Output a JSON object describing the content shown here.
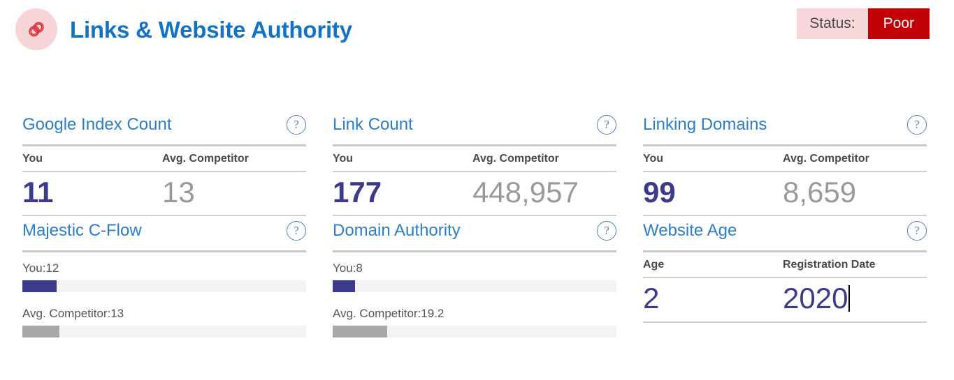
{
  "header": {
    "icon": "chain-link-icon",
    "title": "Links & Website Authority",
    "status_label": "Status:",
    "status_value": "Poor",
    "title_color": "#1273c6",
    "badge_bg": "#f7d4d7",
    "status_label_bg": "#f8d7da",
    "status_value_bg": "#c20008"
  },
  "help_icon_glyph": "?",
  "colors": {
    "you": "#3b3b8c",
    "competitor": "#9a9a9a",
    "card_title": "#2a7fc9",
    "bar_track": "#f4f4f4",
    "bar_you": "#3b3b8c",
    "bar_comp": "#a8a8a8"
  },
  "cards": [
    {
      "id": "google-index-count",
      "type": "stat",
      "title": "Google Index Count",
      "col1_head": "You",
      "col2_head": "Avg. Competitor",
      "col1_value": "11",
      "col2_value": "13"
    },
    {
      "id": "link-count",
      "type": "stat",
      "title": "Link Count",
      "col1_head": "You",
      "col2_head": "Avg. Competitor",
      "col1_value": "177",
      "col2_value": "448,957"
    },
    {
      "id": "linking-domains",
      "type": "stat",
      "title": "Linking Domains",
      "col1_head": "You",
      "col2_head": "Avg. Competitor",
      "col1_value": "99",
      "col2_value": "8,659"
    },
    {
      "id": "majestic-c-flow",
      "type": "bars",
      "title": "Majestic C-Flow",
      "you_label": "You:12",
      "you_value": 12,
      "you_percent": 12,
      "comp_label": "Avg. Competitor:13",
      "comp_value": 13,
      "comp_percent": 13
    },
    {
      "id": "domain-authority",
      "type": "bars",
      "title": "Domain Authority",
      "you_label": "You:8",
      "you_value": 8,
      "you_percent": 8,
      "comp_label": "Avg. Competitor:19.2",
      "comp_value": 19.2,
      "comp_percent": 19.2
    },
    {
      "id": "website-age",
      "type": "stat-navy",
      "title": "Website Age",
      "col1_head": "Age",
      "col2_head": "Registration Date",
      "col1_value": "2",
      "col2_value": "2020"
    }
  ]
}
